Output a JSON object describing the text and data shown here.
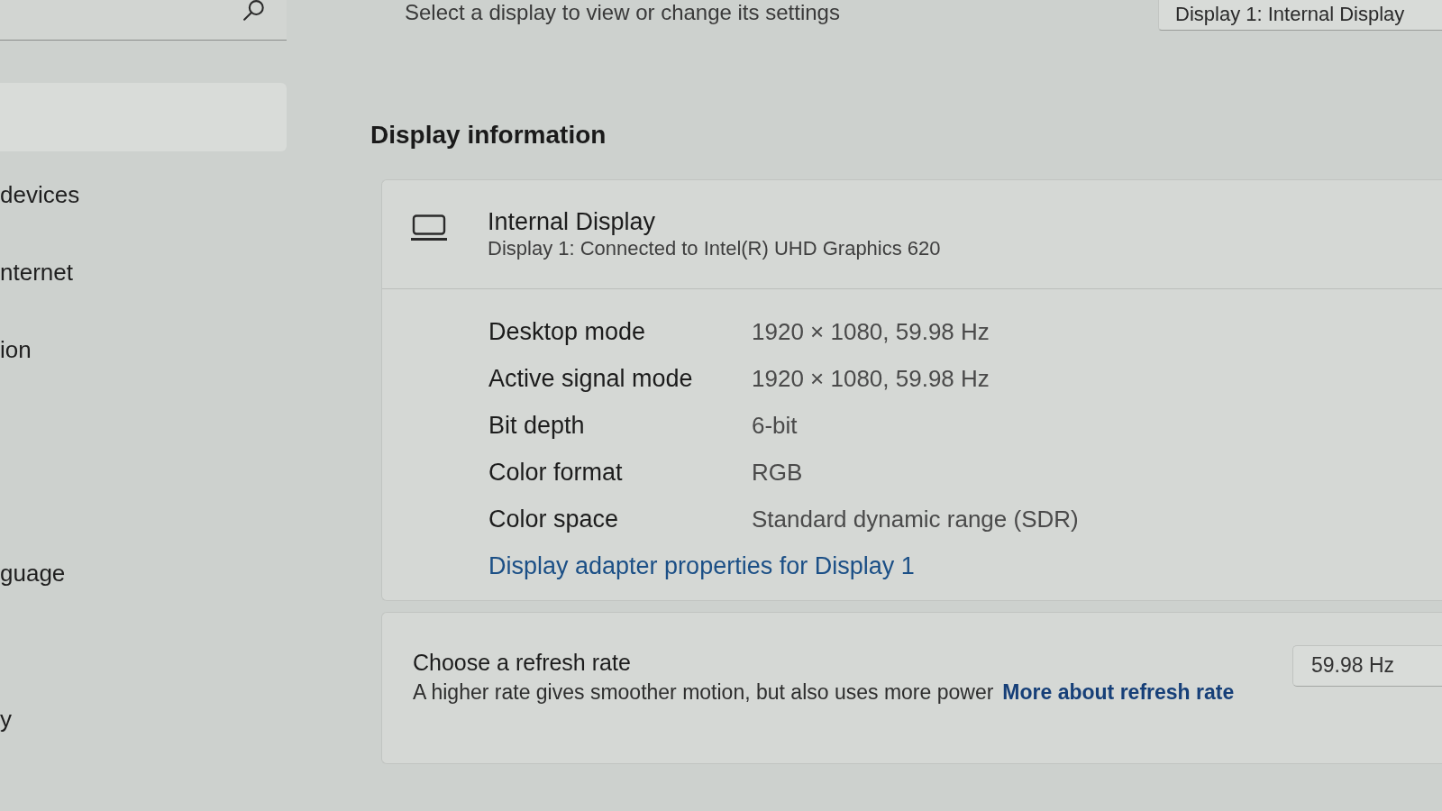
{
  "header": {
    "instruction": "Select a display to view or change its settings",
    "display_select": {
      "value": "Display 1: Internal Display"
    }
  },
  "sidebar": {
    "items": [
      {
        "selected": true
      },
      {
        "label": "devices",
        "selected": false
      },
      {
        "label": "nternet",
        "selected": false
      },
      {
        "label": "ion",
        "selected": false
      },
      {
        "label": "guage",
        "selected": false
      },
      {
        "label": "y",
        "selected": false
      }
    ]
  },
  "section_title": "Display information",
  "display": {
    "name": "Internal Display",
    "description": "Display 1: Connected to Intel(R) UHD Graphics 620"
  },
  "properties": [
    {
      "label": "Desktop mode",
      "value": "1920 × 1080, 59.98 Hz"
    },
    {
      "label": "Active signal mode",
      "value": "1920 × 1080, 59.98 Hz"
    },
    {
      "label": "Bit depth",
      "value": "6-bit"
    },
    {
      "label": "Color format",
      "value": "RGB"
    },
    {
      "label": "Color space",
      "value": "Standard dynamic range (SDR)"
    }
  ],
  "adapter_link": "Display adapter properties for Display 1",
  "refresh_rate": {
    "title": "Choose a refresh rate",
    "description": "A higher rate gives smoother motion, but also uses more power",
    "link": "More about refresh rate",
    "value": "59.98 Hz"
  }
}
